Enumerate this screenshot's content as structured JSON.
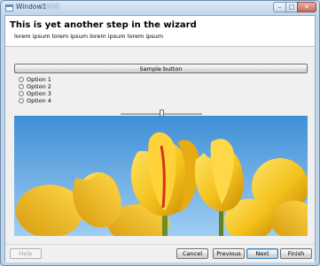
{
  "window": {
    "title": "Window1",
    "title_ghost": "WWW"
  },
  "caption_buttons": {
    "minimize": "–",
    "maximize": "□",
    "close": "✕"
  },
  "header": {
    "title": "This is yet another step in the wizard",
    "description": "lorem ipsum lorem ipsum lorem ipsum lorem ipsum"
  },
  "content": {
    "sample_button_label": "Sample button",
    "options": [
      "Option 1",
      "Option 2",
      "Option 3",
      "Option 4"
    ],
    "slider_value": 0.5,
    "image": {
      "subject": "yellow tulips against blue sky"
    }
  },
  "footer": {
    "help_label": "Help",
    "cancel_label": "Cancel",
    "previous_label": "Previous",
    "next_label": "Next",
    "finish_label": "Finish"
  },
  "colors": {
    "title_text": "#1e395b",
    "sky": "#5aa0dc",
    "tulip": "#f4c21c",
    "tulip_shadow": "#d18f08",
    "accent_red": "#d8321e",
    "default_button_border": "#3c7fb1"
  },
  "icons": {
    "window": "app-window-icon",
    "minimize": "minimize-icon",
    "maximize": "maximize-icon",
    "close": "close-icon"
  }
}
